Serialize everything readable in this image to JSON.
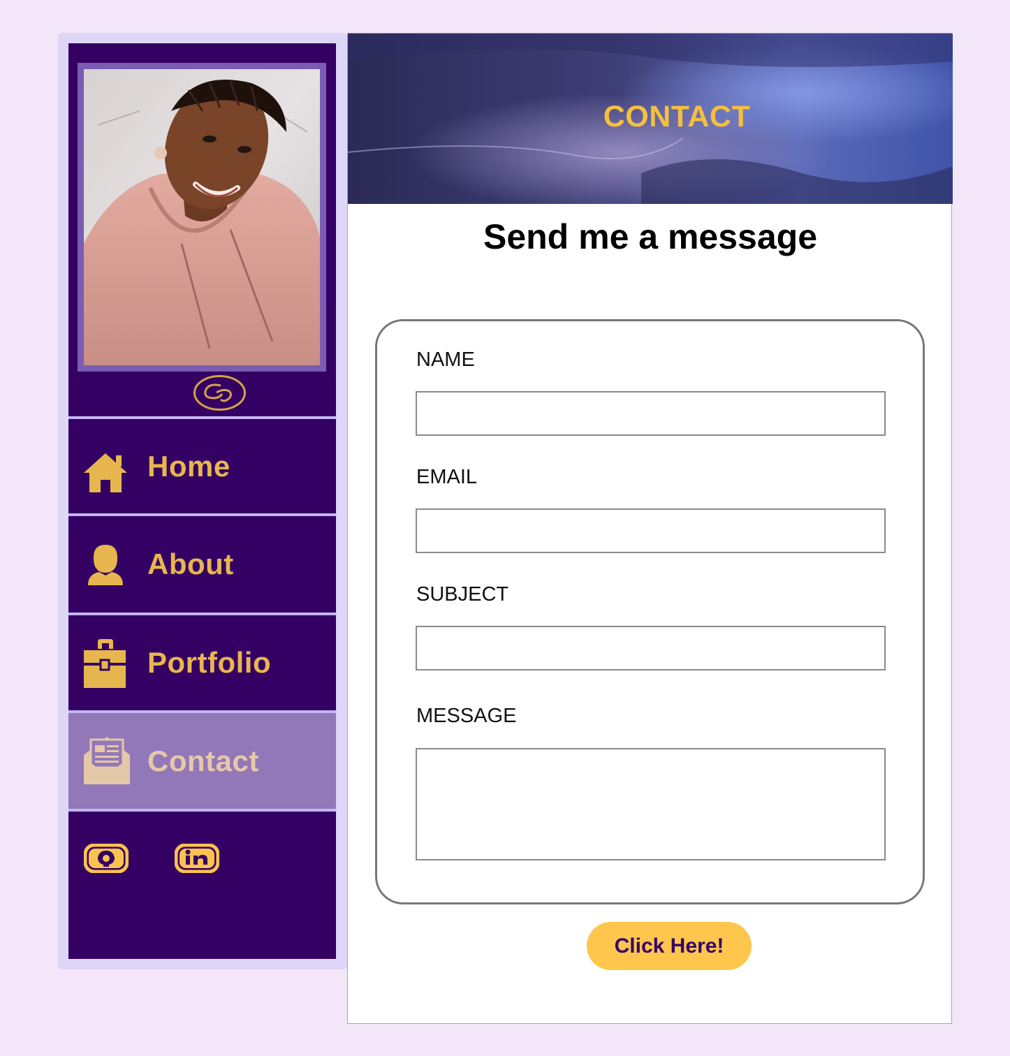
{
  "nav": {
    "items": [
      {
        "label": "Home",
        "icon": "home-icon"
      },
      {
        "label": "About",
        "icon": "user-icon"
      },
      {
        "label": "Portfolio",
        "icon": "briefcase-icon"
      },
      {
        "label": "Contact",
        "icon": "envelope-icon",
        "active": true
      }
    ]
  },
  "social": [
    {
      "icon": "github-icon"
    },
    {
      "icon": "linkedin-icon"
    }
  ],
  "hero": {
    "title": "CONTACT"
  },
  "main": {
    "heading": "Send me a message"
  },
  "form": {
    "name_label": "NAME",
    "email_label": "EMAIL",
    "subject_label": "SUBJECT",
    "message_label": "MESSAGE",
    "name_value": "",
    "email_value": "",
    "subject_value": "",
    "message_value": "",
    "submit_label": "Click Here!"
  },
  "colors": {
    "page_bg": "#f3e6f8",
    "sidebar_bg": "#340063",
    "accent_gold": "#e8b64e",
    "active_nav_bg": "#9378b9",
    "button_bg": "#fec64c",
    "button_text": "#36036a"
  }
}
